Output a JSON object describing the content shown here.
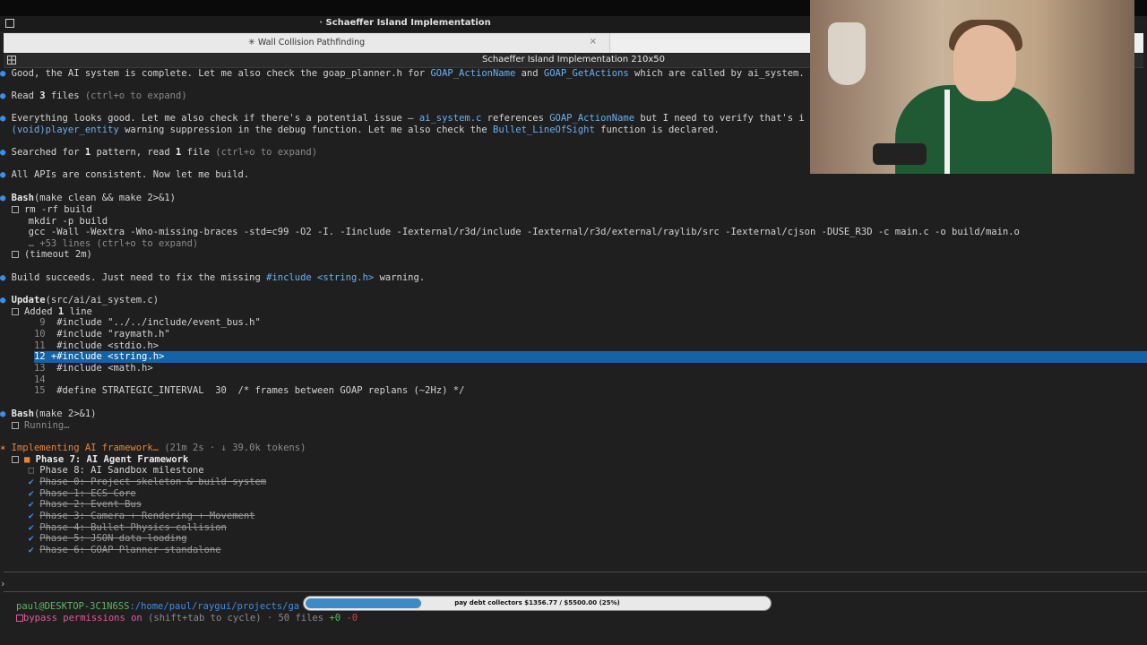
{
  "window_title": "Schaeffer Island Implementation",
  "tab": {
    "label": "✳ Wall Collision Pathfinding",
    "close": "×"
  },
  "terminal_title": "Schaeffer Island Implementation 210x50",
  "lines": {
    "l1a": "Good, the AI system is complete. Let me also check the goap_planner.h for ",
    "l1b": "GOAP_ActionName",
    "l1c": " and ",
    "l1d": "GOAP_GetActions",
    "l1e": " which are called by ai_system.",
    "l2a": "Read ",
    "l2b": "3",
    "l2c": " files ",
    "l2d": "(ctrl+o to expand)",
    "l3a": "Everything looks good. Let me also check if there's a potential issue — ",
    "l3b": "ai_system.c",
    "l3c": " references ",
    "l3d": "GOAP_ActionName",
    "l3e": " but I need to verify that's i",
    "l4a": "(void)player_entity",
    "l4b": " warning suppression in the debug function. Let me also check the ",
    "l4c": "Bullet_LineOfSight",
    "l4d": " function is declared.",
    "l5a": "Searched for ",
    "l5b": "1",
    "l5c": " pattern, read ",
    "l5d": "1",
    "l5e": " file ",
    "l5f": "(ctrl+o to expand)",
    "l6": "All APIs are consistent. Now let me build.",
    "bash1_cmd": "Bash",
    "bash1_args": "(make clean && make 2>&1)",
    "bash1_o1": "rm -rf build",
    "bash1_o2": "mkdir -p build",
    "bash1_o3": "gcc -Wall -Wextra -Wno-missing-braces -std=c99 -O2 -I. -Iinclude -Iexternal/r3d/include -Iexternal/r3d/external/raylib/src -Iexternal/cjson -DUSE_R3D -c main.c -o build/main.o",
    "bash1_o4": "… +53 lines (ctrl+o to expand)",
    "bash1_o5": "(timeout 2m)",
    "l7a": "Build succeeds. Just need to fix the missing ",
    "l7b": "#include <string.h>",
    "l7c": " warning.",
    "upd_cmd": "Update",
    "upd_args": "(src/ai/ai_system.c)",
    "upd_added_a": "Added ",
    "upd_added_b": "1",
    "upd_added_c": " line",
    "code": [
      {
        "num": "9",
        "text": "  #include \"../../include/event_bus.h\""
      },
      {
        "num": "10",
        "text": "  #include \"raymath.h\""
      },
      {
        "num": "11",
        "text": "  #include <stdio.h>"
      },
      {
        "num": "12",
        "text": " +#include <string.h>"
      },
      {
        "num": "13",
        "text": "  #include <math.h>"
      },
      {
        "num": "14",
        "text": ""
      },
      {
        "num": "15",
        "text": "  #define STRATEGIC_INTERVAL  30  /* frames between GOAP replans (~2Hz) */"
      }
    ],
    "bash2_cmd": "Bash",
    "bash2_args": "(make 2>&1)",
    "bash2_o1": "Running…",
    "impl_a": "Implementing AI framework…",
    "impl_b": " (21m 2s · ↓ 39.0k tokens)",
    "phases": {
      "p7": "Phase 7: AI Agent Framework",
      "p8": "Phase 8: AI Sandbox milestone",
      "done": [
        "Phase 0: Project skeleton & build system",
        "Phase 1: ECS Core",
        "Phase 2: Event Bus",
        "Phase 3: Camera + Rendering + Movement",
        "Phase 4: Bullet Physics collision",
        "Phase 5: JSON data loading",
        "Phase 6: GOAP Planner standalone"
      ]
    },
    "prompt_caret": "›",
    "status_user": "paul@DESKTOP-3C1N6SS",
    "status_path": ":/home/paul/raygui/projects/ga",
    "perm_a": "bypass permissions on",
    "perm_b": " (shift+tab to cycle) · 50 files ",
    "perm_c": "+0",
    "perm_d": " -0"
  },
  "progress": {
    "label": "pay debt collectors $1356.77 / $5500.00 (25%)",
    "fraction": 0.25
  },
  "colors": {
    "accent": "#3b8eea",
    "progress_fill": "#3c8ac8",
    "highlight_row": "#1464a5"
  }
}
